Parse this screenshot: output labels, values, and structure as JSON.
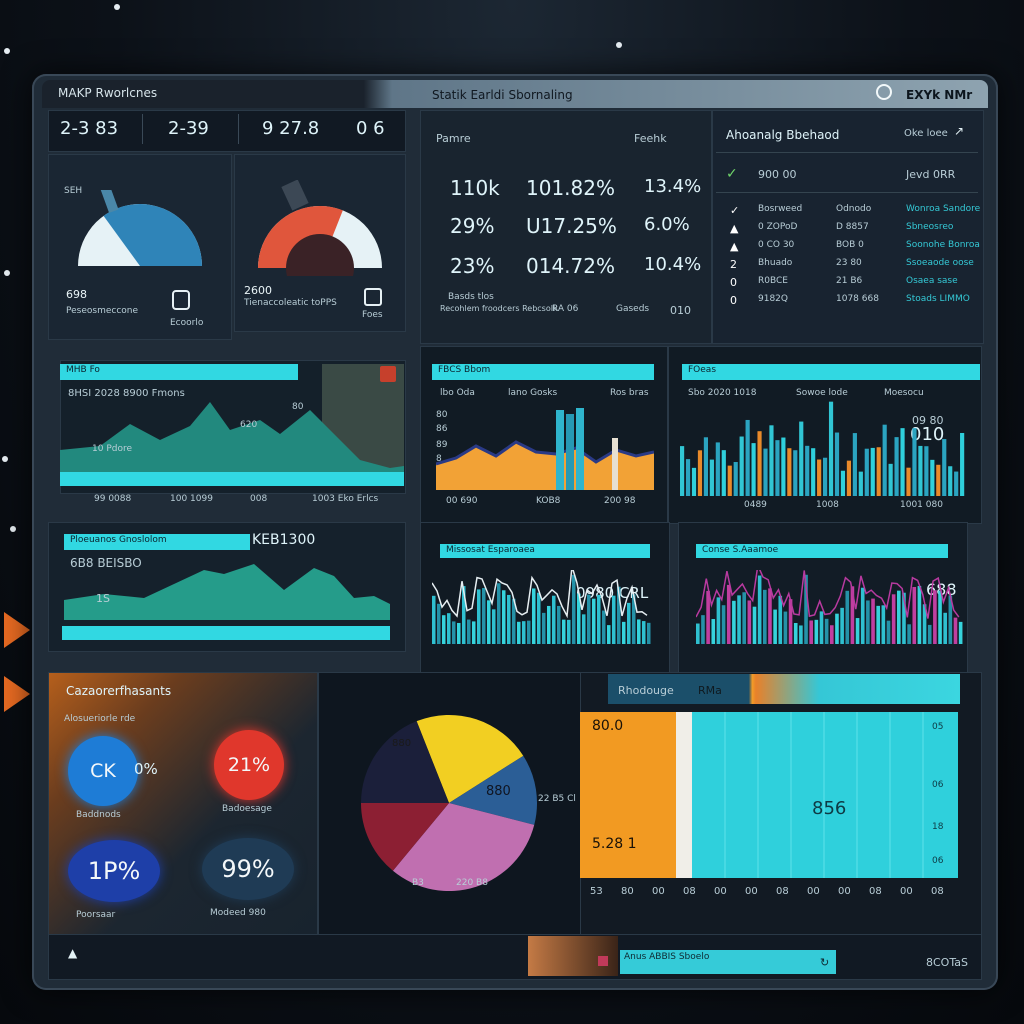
{
  "window": {
    "title_left": "MAKP Rworlcnes",
    "title_center": "Statik Earldi Sbornaling",
    "title_right": "EXYk  NMr"
  },
  "stats_row": {
    "a": "2-3 83",
    "b": "2-39",
    "c": "9 27.8",
    "d": "0 6"
  },
  "gauges": [
    {
      "top_label": "SEH",
      "value": "698",
      "caption": "Peseosmeccone",
      "icon_label": "Ecoorlo",
      "level": 0.3,
      "accent": "#2f84b8"
    },
    {
      "top_label": "",
      "value": "2600",
      "caption": "Tienaccoleatic toPPS",
      "icon_label": "Foes",
      "level": 0.62,
      "accent": "#e0563c"
    }
  ],
  "metrics_panel": {
    "title": "Pamre",
    "right_label": "Feehk",
    "rows": [
      [
        "110k",
        "101.82%",
        "13.4%"
      ],
      [
        "29%",
        "U17.25%",
        "6.0%"
      ],
      [
        "23%",
        "014.72%",
        "10.4%"
      ]
    ],
    "foot_left_1": "Basds tlos",
    "foot_left_2": "Recohlem froodcers Rebcsolk",
    "foot_mid": "RA 06",
    "foot_right": "Gaseds",
    "foot_right_val": "010"
  },
  "activity_panel": {
    "title": "Ahoanalg Bbehaod",
    "right_label": "Oke loee",
    "sub_left": "900 00",
    "sub_right": "Jevd 0RR",
    "rows": [
      {
        "icon": "✓",
        "a": "Bosrweed",
        "b": "Odnodo",
        "c": "Wonroa Sandore"
      },
      {
        "icon": "▲",
        "a": "0 ZOPoD",
        "b": "D 8857",
        "c": "Sbneosreo"
      },
      {
        "icon": "▲",
        "a": "0 CO 30",
        "b": "BOB 0",
        "c": "Soonohe Bonroa"
      },
      {
        "icon": "2",
        "a": "Bhuado",
        "b": "23 80",
        "c": "Ssoeaode oose"
      },
      {
        "icon": "0",
        "a": "R0BCE",
        "b": "21 B6",
        "c": "Osaea sase"
      },
      {
        "icon": "0",
        "a": "9182Q",
        "b": "1078 668",
        "c": "Stoads LIMMO"
      }
    ]
  },
  "chart_a": {
    "header": "MHB Fo",
    "title": "8HSI 2028 8900 Fmons",
    "label_1": "10 Pdore",
    "label_2": "620",
    "label_3": "80",
    "axis": [
      "99 0088",
      "100 1099",
      "008",
      "1003 Eko Erlcs"
    ]
  },
  "chart_b": {
    "header": "FBCS Bbom",
    "labels": [
      "lbo Oda",
      "lano Gosks",
      "Ros bras"
    ],
    "side": [
      "80",
      "86",
      "89",
      "8",
      "80"
    ],
    "axis": [
      "00 690",
      "KOB8",
      "200 98"
    ]
  },
  "chart_c": {
    "header": "FOeas",
    "labels": [
      "Sbo 2020 1018",
      "Sowoe lode",
      "Moesocu"
    ],
    "value": "010",
    "value2": "09 80",
    "axis": [
      "0489",
      "1008",
      "1001 080"
    ]
  },
  "chart_d": {
    "header": "Ploeuanos Gnoslolom",
    "big": "KEB1300",
    "label": "6B8 BEISBO",
    "sub": "1S"
  },
  "chart_e": {
    "header": "Missosat Esparoaea",
    "value": "0980 CRL"
  },
  "chart_f": {
    "header": "Conse S.Aaamoe",
    "value": "688"
  },
  "kpi_panel": {
    "title": "Cazaorerfhasants",
    "subtitle": "Alosueriorle rde",
    "items": [
      {
        "value": "CK",
        "suffix": "0%",
        "caption": "Baddnods",
        "color": "#1e7cd6"
      },
      {
        "value": "21%",
        "suffix": "",
        "caption": "Badoesage",
        "color": "#e0372c"
      },
      {
        "value": "1P%",
        "suffix": "",
        "caption": "Poorsaar",
        "color": "#1e3fa8"
      },
      {
        "value": "99%",
        "suffix": "",
        "caption": "Modeed 980",
        "color": "#1f3b55"
      }
    ]
  },
  "pie": {
    "labels": {
      "top": "880",
      "mid": "880",
      "right": "22 B5 Cl",
      "bottom_left": "B3",
      "bottom_right": "220 B8"
    },
    "slices": [
      {
        "value": 0.22,
        "color": "#f2cf22"
      },
      {
        "value": 0.13,
        "color": "#2b5e96"
      },
      {
        "value": 0.32,
        "color": "#c06fb0"
      },
      {
        "value": 0.14,
        "color": "#8c1f33"
      },
      {
        "value": 0.19,
        "color": "#1b1f3a"
      }
    ]
  },
  "bar_panel": {
    "tab_1": "Rhodouge",
    "tab_2": "RMa",
    "left_top": "80.0",
    "left_bottom": "5.28 1",
    "mid": "856",
    "right_ticks": [
      "05",
      "06",
      "18",
      "06"
    ],
    "axis": [
      "53",
      "80",
      "00",
      "08",
      "00",
      "00",
      "08",
      "00",
      "00",
      "08",
      "00",
      "08"
    ]
  },
  "footer": {
    "right_label": "Anus ABBIS Sboelo",
    "right_text": "8COTaS"
  }
}
